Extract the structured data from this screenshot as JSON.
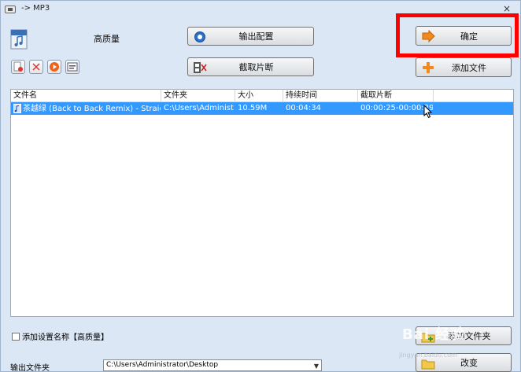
{
  "window": {
    "title": "-> MP3",
    "close_glyph": "×"
  },
  "header": {
    "quality": "高质量"
  },
  "toolbar": {
    "output_config": "输出配置",
    "trim": "截取片断",
    "ok": "确定",
    "add_file": "添加文件",
    "add_folder": "添加文件夹",
    "change": "改变"
  },
  "table": {
    "columns": [
      "文件名",
      "文件夹",
      "大小",
      "持续时间",
      "截取片断"
    ],
    "rows": [
      {
        "name": "茶越绿 (Back to Back Remix) - Straight Fir...",
        "folder": "C:\\Users\\Administ...",
        "size": "10.59M",
        "duration": "00:04:34",
        "trim": "00:00:25-00:00:29"
      }
    ]
  },
  "options": {
    "add_setting_name": "添加设置名称【高质量】"
  },
  "output": {
    "label": "输出文件夹",
    "path": "C:\\Users\\Administrator\\Desktop"
  },
  "watermark": {
    "text": "Bai 经验",
    "sub": "jingyan.baidu.com"
  },
  "colors": {
    "selection": "#3399ff",
    "highlight": "#ff0000",
    "background": "#dce7f5"
  }
}
